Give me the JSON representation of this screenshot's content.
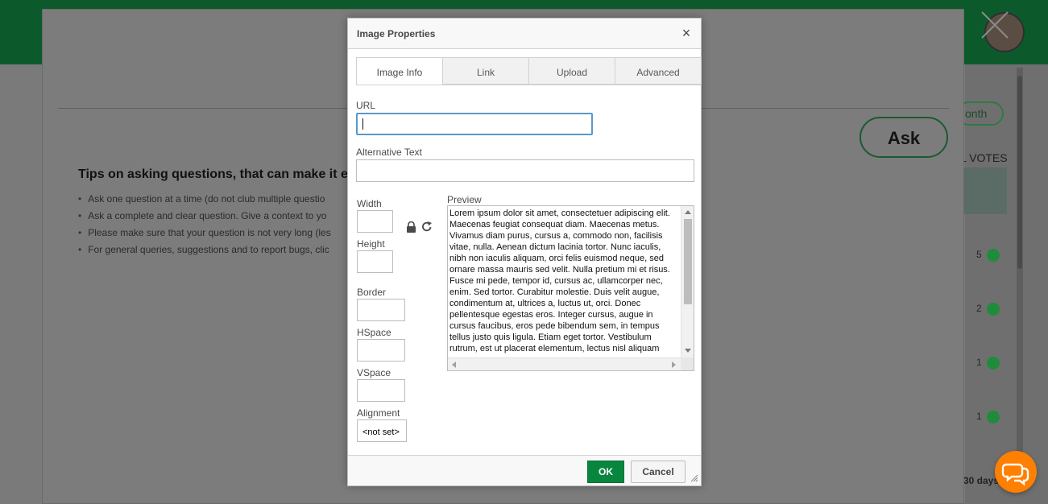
{
  "background": {
    "ask_button": "Ask",
    "month_pill": "onth",
    "votes_header": "L VOTES",
    "tips_title": "Tips on asking questions, that can make it e",
    "tips": [
      "Ask one question at a time (do not club multiple questio",
      "Ask a complete and clear question. Give a context to yo",
      "Please make sure that your question is not very long (les",
      "For general queries, suggestions and to report bugs, clic"
    ],
    "votes": [
      "5",
      "2",
      "1",
      "1"
    ],
    "days_label": "30 days"
  },
  "dialog": {
    "title": "Image Properties",
    "close_glyph": "×",
    "tabs": [
      "Image Info",
      "Link",
      "Upload",
      "Advanced"
    ],
    "active_tab": "Image Info",
    "fields": {
      "url_label": "URL",
      "url_value": "",
      "alt_label": "Alternative Text",
      "alt_value": "",
      "width_label": "Width",
      "height_label": "Height",
      "border_label": "Border",
      "hspace_label": "HSpace",
      "vspace_label": "VSpace",
      "alignment_label": "Alignment",
      "alignment_value": "<not set>"
    },
    "preview_label": "Preview",
    "preview_text": "Lorem ipsum dolor sit amet, consectetuer adipiscing elit. Maecenas feugiat consequat diam. Maecenas metus. Vivamus diam purus, cursus a, commodo non, facilisis vitae, nulla. Aenean dictum lacinia tortor. Nunc iaculis, nibh non iaculis aliquam, orci felis euismod neque, sed ornare massa mauris sed velit. Nulla pretium mi et risus. Fusce mi pede, tempor id, cursus ac, ullamcorper nec, enim. Sed tortor. Curabitur molestie. Duis velit augue, condimentum at, ultrices a, luctus ut, orci. Donec pellentesque egestas eros. Integer cursus, augue in cursus faucibus, eros pede bibendum sem, in tempus tellus justo quis ligula. Etiam eget tortor. Vestibulum rutrum, est ut placerat elementum, lectus nisl aliquam velit, tempor aliquam eros nunc nonummy metus.",
    "ok_label": "OK",
    "cancel_label": "Cancel"
  },
  "colors": {
    "ok_green": "#09863e",
    "focus_blue": "#5b98c9",
    "chat_orange": "#ff7f00",
    "header_green": "#0c5a2c"
  },
  "icons": [
    "lock-icon",
    "reset-size-icon",
    "close-icon",
    "resize-grip-icon",
    "chat-icon"
  ]
}
